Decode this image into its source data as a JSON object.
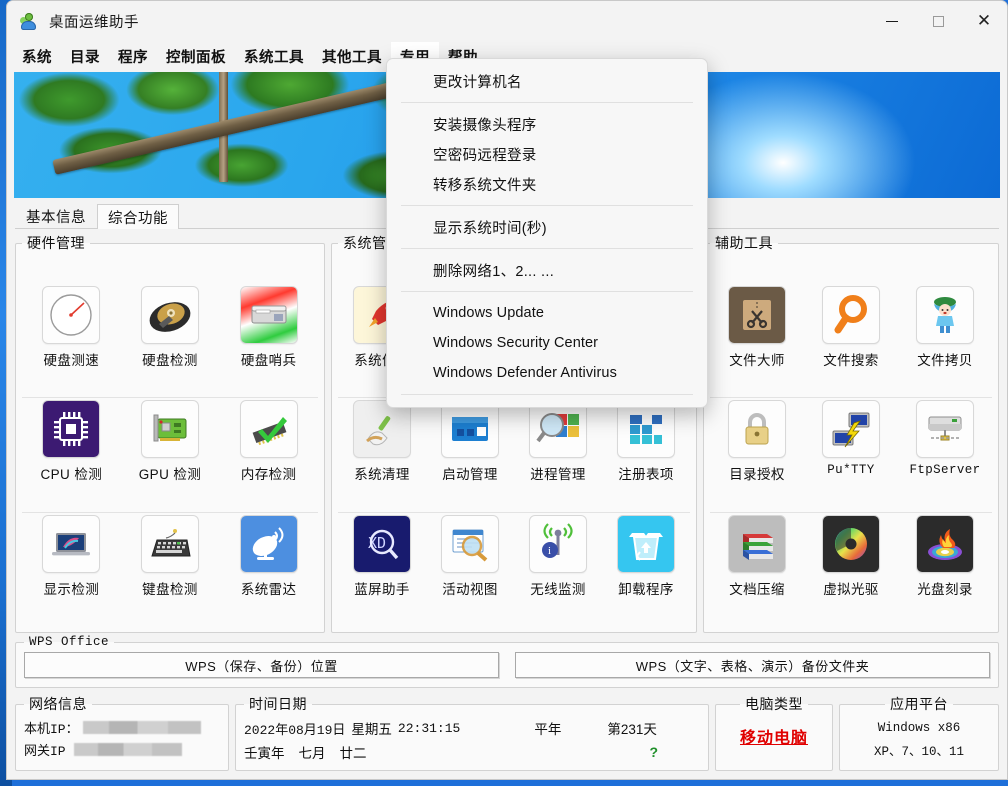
{
  "window": {
    "title": "桌面运维助手",
    "app_icon": "users-icon",
    "buttons": {
      "minimize": "—",
      "maximize": "▢",
      "close": "✕"
    }
  },
  "menubar": {
    "items": [
      {
        "label": "系统",
        "name": "menu-system",
        "active": false
      },
      {
        "label": "目录",
        "name": "menu-directory",
        "active": false
      },
      {
        "label": "程序",
        "name": "menu-program",
        "active": false
      },
      {
        "label": "控制面板",
        "name": "menu-control-panel",
        "active": false
      },
      {
        "label": "系统工具",
        "name": "menu-system-tools",
        "active": false
      },
      {
        "label": "其他工具",
        "name": "menu-other-tools",
        "active": false
      },
      {
        "label": "专用",
        "name": "menu-dedicated",
        "active": true
      },
      {
        "label": "帮助",
        "name": "menu-help",
        "active": false
      }
    ]
  },
  "dropdown": {
    "open_for": "专用",
    "items": [
      {
        "label": "更改计算机名",
        "type": "item"
      },
      {
        "type": "separator"
      },
      {
        "label": "安装摄像头程序",
        "type": "item"
      },
      {
        "label": "空密码远程登录",
        "type": "item"
      },
      {
        "label": "转移系统文件夹",
        "type": "item"
      },
      {
        "type": "separator"
      },
      {
        "label": "显示系统时间(秒)",
        "type": "item"
      },
      {
        "type": "separator"
      },
      {
        "label": "删除网络1、2... ...",
        "type": "item"
      },
      {
        "type": "separator"
      },
      {
        "label": "Windows Update",
        "type": "item",
        "latin": true
      },
      {
        "label": "Windows Security Center",
        "type": "item",
        "latin": true
      },
      {
        "label": "Windows Defender Antivirus",
        "type": "item",
        "latin": true
      },
      {
        "type": "separator"
      }
    ]
  },
  "banner": {
    "description": "tropical-palm-trees-blue-sky-photo"
  },
  "tabs": [
    {
      "label": "基本信息",
      "selected": false
    },
    {
      "label": "综合功能",
      "selected": true
    }
  ],
  "panes": {
    "hardware": {
      "title": "硬件管理",
      "rows": [
        [
          {
            "label": "硬盘测速",
            "icon": "speedometer-icon"
          },
          {
            "label": "硬盘检测",
            "icon": "hard-disk-icon"
          },
          {
            "label": "硬盘哨兵",
            "icon": "disk-sentinel-icon"
          }
        ],
        [
          {
            "label": "CPU 检测",
            "icon": "cpu-chip-icon"
          },
          {
            "label": "GPU 检测",
            "icon": "graphics-card-icon"
          },
          {
            "label": "内存检测",
            "icon": "memory-check-icon"
          }
        ],
        [
          {
            "label": "显示检测",
            "icon": "laptop-display-icon"
          },
          {
            "label": "键盘检测",
            "icon": "keyboard-icon"
          },
          {
            "label": "系统雷达",
            "icon": "satellite-dish-icon"
          }
        ]
      ]
    },
    "system": {
      "title": "系统管理",
      "rows": [
        [
          {
            "label": "系统优化",
            "icon": "rocket-icon"
          },
          {
            "label": "",
            "icon": "hidden-behind-menu"
          },
          {
            "label": "",
            "icon": "hidden-behind-menu"
          },
          {
            "label": "",
            "icon": "hidden-behind-menu"
          }
        ],
        [
          {
            "label": "系统清理",
            "icon": "broom-icon"
          },
          {
            "label": "启动管理",
            "icon": "startup-window-icon"
          },
          {
            "label": "进程管理",
            "icon": "process-magnifier-icon"
          },
          {
            "label": "注册表项",
            "icon": "registry-blocks-icon"
          }
        ],
        [
          {
            "label": "蓝屏助手",
            "icon": "bluescreen-magnifier-icon"
          },
          {
            "label": "活动视图",
            "icon": "activity-view-icon"
          },
          {
            "label": "无线监测",
            "icon": "wireless-monitor-icon"
          },
          {
            "label": "卸载程序",
            "icon": "uninstall-trash-icon"
          }
        ]
      ]
    },
    "tools": {
      "title": "辅助工具",
      "rows": [
        [
          {
            "label": "文件大师",
            "icon": "scissors-folder-icon"
          },
          {
            "label": "文件搜索",
            "icon": "magnifier-orange-icon"
          },
          {
            "label": "文件拷贝",
            "icon": "anime-girl-icon"
          }
        ],
        [
          {
            "label": "目录授权",
            "icon": "padlock-icon"
          },
          {
            "label": "Pu*TTY",
            "icon": "putty-terminal-icon",
            "mono": true
          },
          {
            "label": "FtpServer",
            "icon": "ftp-server-icon",
            "mono": true
          }
        ],
        [
          {
            "label": "文档压缩",
            "icon": "winrar-books-icon"
          },
          {
            "label": "虚拟光驱",
            "icon": "daemon-tools-icon"
          },
          {
            "label": "光盘刻录",
            "icon": "disc-burn-flame-icon"
          }
        ]
      ]
    }
  },
  "wps": {
    "title": "WPS Office",
    "buttons": [
      {
        "label": "WPS（保存、备份）位置"
      },
      {
        "label": "WPS（文字、表格、演示）备份文件夹"
      }
    ]
  },
  "status": {
    "network": {
      "title": "网络信息",
      "local_ip_label": "本机IP：",
      "local_ip_value": "",
      "gateway_ip_label": "网关IP",
      "gateway_ip_value": ""
    },
    "datetime": {
      "title": "时间日期",
      "date": "2022年08月19日",
      "weekday": "星期五",
      "clock": "22:31:15",
      "year_type": "平年",
      "day_of_year": "第231天",
      "lunar_year": "壬寅年",
      "lunar_month": "七月",
      "lunar_day": "廿二",
      "help_mark": "?"
    },
    "computer_type": {
      "title": "电脑类型",
      "value": "移动电脑"
    },
    "platform": {
      "title": "应用平台",
      "line1": "Windows x86",
      "line2": "XP、7、10、11"
    }
  },
  "colors": {
    "accent_red": "#e00000",
    "accent_green": "#1f8f2a",
    "window_bg": "#f3f3f3",
    "pane_bg": "#fafafa",
    "desktop_blue": "#1e6fd9"
  }
}
